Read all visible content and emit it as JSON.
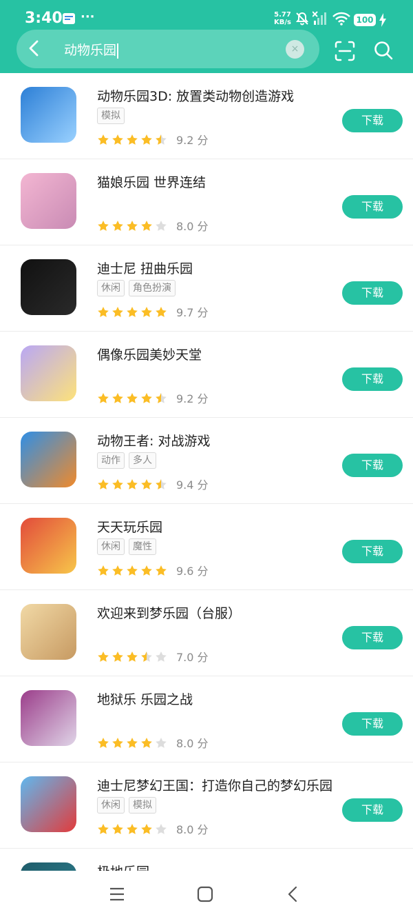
{
  "status_bar": {
    "time": "3:40",
    "more_dots": "···",
    "net_speed_value": "5.77",
    "net_speed_unit": "KB/s",
    "battery": "100"
  },
  "search": {
    "query": "动物乐园",
    "clear_symbol": "×"
  },
  "colors": {
    "accent": "#27c2a3",
    "star_filled": "#fbbd25",
    "star_empty": "#dddddd"
  },
  "results": [
    {
      "name": "动物乐园3D: 放置类动物创造游戏",
      "tags": [
        "模拟"
      ],
      "rating": 4.5,
      "score": "9.2 分",
      "button": "下载",
      "icon": "dinosaur-robot-icon",
      "icon_colors": [
        "#2c7fd6",
        "#9ad1ff"
      ]
    },
    {
      "name": "猫娘乐园 世界连结",
      "tags": [],
      "rating": 4,
      "score": "8.0 分",
      "button": "下载",
      "icon": "catgirl-anime-icon",
      "icon_colors": [
        "#f3b6d2",
        "#c98bb4"
      ]
    },
    {
      "name": "迪士尼 扭曲乐园",
      "tags": [
        "休闲",
        "角色扮演"
      ],
      "rating": 5,
      "score": "9.7 分",
      "button": "下载",
      "icon": "twisted-wonderland-logo-icon",
      "icon_colors": [
        "#111111",
        "#2a2a2a"
      ]
    },
    {
      "name": "偶像乐园美妙天堂",
      "tags": [],
      "rating": 4.5,
      "score": "9.2 分",
      "button": "下载",
      "icon": "golden-heart-keyhole-icon",
      "icon_colors": [
        "#b9a7f5",
        "#fde27a"
      ]
    },
    {
      "name": "动物王者: 对战游戏",
      "tags": [
        "动作",
        "多人"
      ],
      "rating": 4.5,
      "score": "9.4 分",
      "button": "下载",
      "icon": "zooba-fox-icon",
      "icon_colors": [
        "#2f8fe6",
        "#f08a2b"
      ]
    },
    {
      "name": "天天玩乐园",
      "tags": [
        "休闲",
        "魔性"
      ],
      "rating": 5,
      "score": "9.6 分",
      "button": "下载",
      "icon": "crowd-faces-icon",
      "icon_colors": [
        "#e24b3b",
        "#f7c64a"
      ]
    },
    {
      "name": "欢迎来到梦乐园（台服）",
      "tags": [],
      "rating": 3.5,
      "score": "7.0 分",
      "button": "下载",
      "icon": "anime-boy-icon",
      "icon_colors": [
        "#f1d9a6",
        "#c79a62"
      ]
    },
    {
      "name": "地狱乐 乐园之战",
      "tags": [],
      "rating": 4,
      "score": "8.0 分",
      "button": "下载",
      "icon": "anime-silver-hair-icon",
      "icon_colors": [
        "#9b3d8a",
        "#e0d5e8"
      ]
    },
    {
      "name": "迪士尼梦幻王国：打造你自己的梦幻乐园",
      "tags": [
        "休闲",
        "模拟"
      ],
      "rating": 4,
      "score": "8.0 分",
      "button": "下载",
      "icon": "mickey-castle-icon",
      "icon_colors": [
        "#5fb8ef",
        "#e23b3b"
      ]
    },
    {
      "name": "极地乐园",
      "tags": [],
      "rating": 0,
      "score": "",
      "button": "",
      "icon": "polar-park-icon",
      "icon_colors": [
        "#1f5d6b",
        "#2f7f8e"
      ]
    }
  ]
}
